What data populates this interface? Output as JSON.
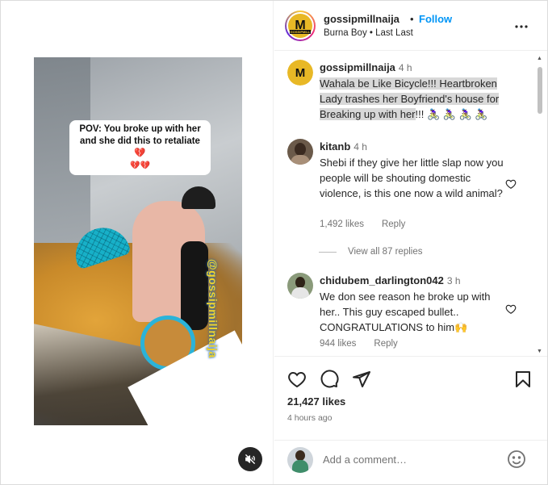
{
  "media": {
    "caption_text": "POV: You broke up with her and she did this to retaliate 💔",
    "caption_hearts": "💔💔",
    "watermark": "@gossipmillnaija"
  },
  "header": {
    "username": "gossipmillnaija",
    "dot": "•",
    "follow_label": "Follow",
    "subtitle": "Burna Boy • Last Last",
    "logo_letter": "M",
    "logo_tag": "GOSSIPMILL"
  },
  "caption_comment": {
    "username": "gossipmillnaija",
    "time": "4 h",
    "line1": "Wahala be Like Bicycle!!! Heartbroken",
    "line2": "Lady trashes her Boyfriend's house for",
    "line3_hl": "Breaking up with her",
    "line3_rest": "!!! 🚴🏾‍♀️ 🚴🏾‍♀️ 🚴🏾‍♀️ 🚴🏾‍♀️"
  },
  "comments": [
    {
      "username": "kitanb",
      "time": "4 h",
      "text": "Shebi if they give her little slap now you people will be shouting domestic violence, is this one now a wild animal?",
      "likes": "1,492 likes",
      "reply": "Reply"
    },
    {
      "username": "chidubem_darlington042",
      "time": "3 h",
      "text": "We don see reason he broke up with her.. This guy escaped bullet.. CONGRATULATIONS to him🙌",
      "likes": "944 likes",
      "reply": "Reply"
    }
  ],
  "view_replies": "View all 87 replies",
  "post": {
    "likes": "21,427 likes",
    "ago": "4 hours ago"
  },
  "add_comment": {
    "placeholder": "Add a comment…"
  },
  "icons": {
    "more": "more-icon",
    "heart": "heart-icon",
    "comment": "comment-icon",
    "share": "share-icon",
    "save": "bookmark-icon",
    "emoji": "emoji-icon",
    "mute": "muted-speaker-icon"
  }
}
